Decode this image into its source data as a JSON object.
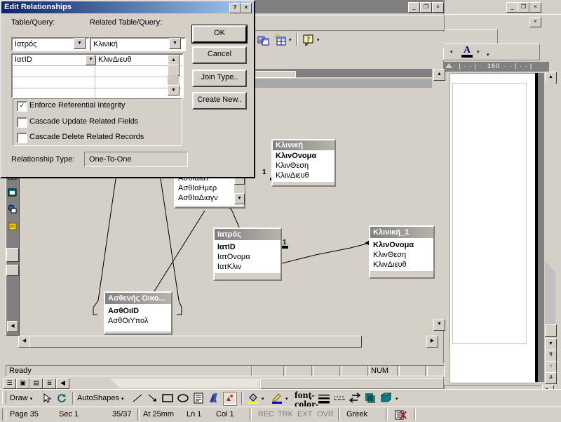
{
  "dialog": {
    "title": "Edit Relationships",
    "help_button": "?",
    "close_button": "×",
    "labels": {
      "table_query": "Table/Query:",
      "related_table_query": "Related Table/Query:",
      "relationship_type": "Relationship Type:"
    },
    "left_table": "Ιατρός",
    "right_table": "Κλινική",
    "grid_rows": [
      {
        "left": "ΙατID",
        "right": "ΚλινΔιευθ"
      },
      {
        "left": "",
        "right": ""
      },
      {
        "left": "",
        "right": ""
      },
      {
        "left": "",
        "right": ""
      }
    ],
    "checkboxes": [
      {
        "label": "Enforce Referential Integrity",
        "checked": true,
        "mark": "✓"
      },
      {
        "label": "Cascade Update Related Fields",
        "checked": false,
        "mark": ""
      },
      {
        "label": "Cascade Delete Related Records",
        "checked": false,
        "mark": ""
      }
    ],
    "relationship_type_value": "One-To-One",
    "buttons": {
      "ok": "OK",
      "cancel": "Cancel",
      "join_type": "Join Type..",
      "create_new": "Create New.."
    }
  },
  "access": {
    "titlebar_buttons": {
      "minimize": "_",
      "restore": "❐",
      "close": "×"
    },
    "status": {
      "message": "Ready",
      "num": "NUM"
    },
    "toolbar_icons": [
      "relationships-icon",
      "show-table-icon",
      "office-assistant-icon"
    ]
  },
  "relationships": {
    "tables": [
      {
        "name": "Κλινική",
        "fields": [
          {
            "label": "ΚλινΟνομα",
            "key": true
          },
          {
            "label": "ΚλινΘεση",
            "key": false
          },
          {
            "label": "ΚλινΔιευθ",
            "key": false
          }
        ]
      },
      {
        "name": "Ιατρός",
        "fields": [
          {
            "label": "ΙατID",
            "key": true
          },
          {
            "label": "ΙατΟνομα",
            "key": false
          },
          {
            "label": "ΙατΚλιν",
            "key": false
          }
        ]
      },
      {
        "name": "Κλινική_1",
        "fields": [
          {
            "label": "ΚλινΟνομα",
            "key": true
          },
          {
            "label": "ΚλινΘεση",
            "key": false
          },
          {
            "label": "ΚλινΔιευθ",
            "key": false
          }
        ]
      },
      {
        "name": "Ασθενής Οικο...",
        "fields": [
          {
            "label": "ΑσθΟιID",
            "key": true
          },
          {
            "label": "ΑσθΟιΥπολ",
            "key": false
          }
        ]
      },
      {
        "name": "",
        "fields": [
          {
            "label": "ΑσθΙαΙατ",
            "key": false
          },
          {
            "label": "ΑσθΙαΗμερ",
            "key": false
          },
          {
            "label": "ΑσθΙαΔιαγν",
            "key": false
          }
        ]
      }
    ],
    "cardinality_labels": [
      "1",
      "1"
    ]
  },
  "word": {
    "titlebar_buttons": {
      "minimize": "_",
      "restore": "❐",
      "close": "×"
    },
    "doc_close_button": "×",
    "ruler_label": "160",
    "font_color_icon": "A"
  },
  "draw_toolbar": {
    "draw_label": "Draw",
    "autoshapes_label": "AutoShapes",
    "dropdown_arrow": "▾",
    "items": [
      "select-objects-icon",
      "free-rotate-icon",
      "line-icon",
      "arrow-icon",
      "rectangle-icon",
      "oval-icon",
      "text-box-icon",
      "wordart-icon",
      "insert-picture-icon",
      "fill-color-icon",
      "line-color-icon",
      "font-color-icon",
      "line-style-icon",
      "dash-style-icon",
      "arrow-style-icon",
      "shadow-icon",
      "3d-icon"
    ]
  },
  "word_status": {
    "page": "Page 35",
    "sec": "Sec 1",
    "pages": "35/37",
    "at": "At 25mm",
    "ln": "Ln 1",
    "col": "Col 1",
    "rec": "REC",
    "trk": "TRK",
    "ext": "EXT",
    "ovr": "OVR",
    "language": "Greek",
    "spell_icon": "spell-check-icon"
  }
}
